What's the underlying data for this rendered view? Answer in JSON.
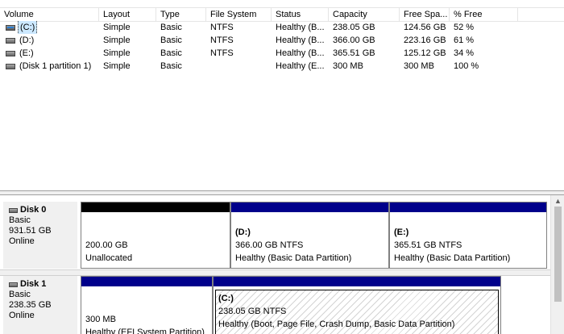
{
  "volume_list": {
    "columns": [
      "Volume",
      "Layout",
      "Type",
      "File System",
      "Status",
      "Capacity",
      "Free Spa...",
      "% Free"
    ],
    "rows": [
      {
        "volume": "(C:)",
        "layout": "Simple",
        "type": "Basic",
        "file_system": "NTFS",
        "status": "Healthy (B...",
        "capacity": "238.05 GB",
        "free_space": "124.56 GB",
        "pct_free": "52 %",
        "icon": "drive-icon"
      },
      {
        "volume": "(D:)",
        "layout": "Simple",
        "type": "Basic",
        "file_system": "NTFS",
        "status": "Healthy (B...",
        "capacity": "366.00 GB",
        "free_space": "223.16 GB",
        "pct_free": "61 %",
        "icon": "drive-icon"
      },
      {
        "volume": "(E:)",
        "layout": "Simple",
        "type": "Basic",
        "file_system": "NTFS",
        "status": "Healthy (B...",
        "capacity": "365.51 GB",
        "free_space": "125.12 GB",
        "pct_free": "34 %",
        "icon": "drive-icon"
      },
      {
        "volume": "(Disk 1 partition 1)",
        "layout": "Simple",
        "type": "Basic",
        "file_system": "",
        "status": "Healthy (E...",
        "capacity": "300 MB",
        "free_space": "300 MB",
        "pct_free": "100 %",
        "icon": "drive-icon"
      }
    ]
  },
  "disks": [
    {
      "name": "Disk 0",
      "type": "Basic",
      "size": "931.51 GB",
      "state": "Online",
      "partitions": [
        {
          "label": "",
          "size": "200.00 GB",
          "status": "Unallocated",
          "bar": "black"
        },
        {
          "label": "(D:)",
          "size": "366.00 GB NTFS",
          "status": "Healthy (Basic Data Partition)",
          "bar": "blue"
        },
        {
          "label": "(E:)",
          "size": "365.51 GB NTFS",
          "status": "Healthy (Basic Data Partition)",
          "bar": "blue"
        }
      ]
    },
    {
      "name": "Disk 1",
      "type": "Basic",
      "size": "238.35 GB",
      "state": "Online",
      "partitions": [
        {
          "label": "",
          "size": "300 MB",
          "status": "Healthy (EFI System Partition)",
          "bar": "blue"
        },
        {
          "label": "(C:)",
          "size": "238.05 GB NTFS",
          "status": "Healthy (Boot, Page File, Crash Dump, Basic Data Partition)",
          "bar": "blue",
          "selected": true
        }
      ]
    }
  ],
  "colors": {
    "primary_bar": "#00008b",
    "unallocated_bar": "#000000",
    "selection": "#cce8ff"
  }
}
